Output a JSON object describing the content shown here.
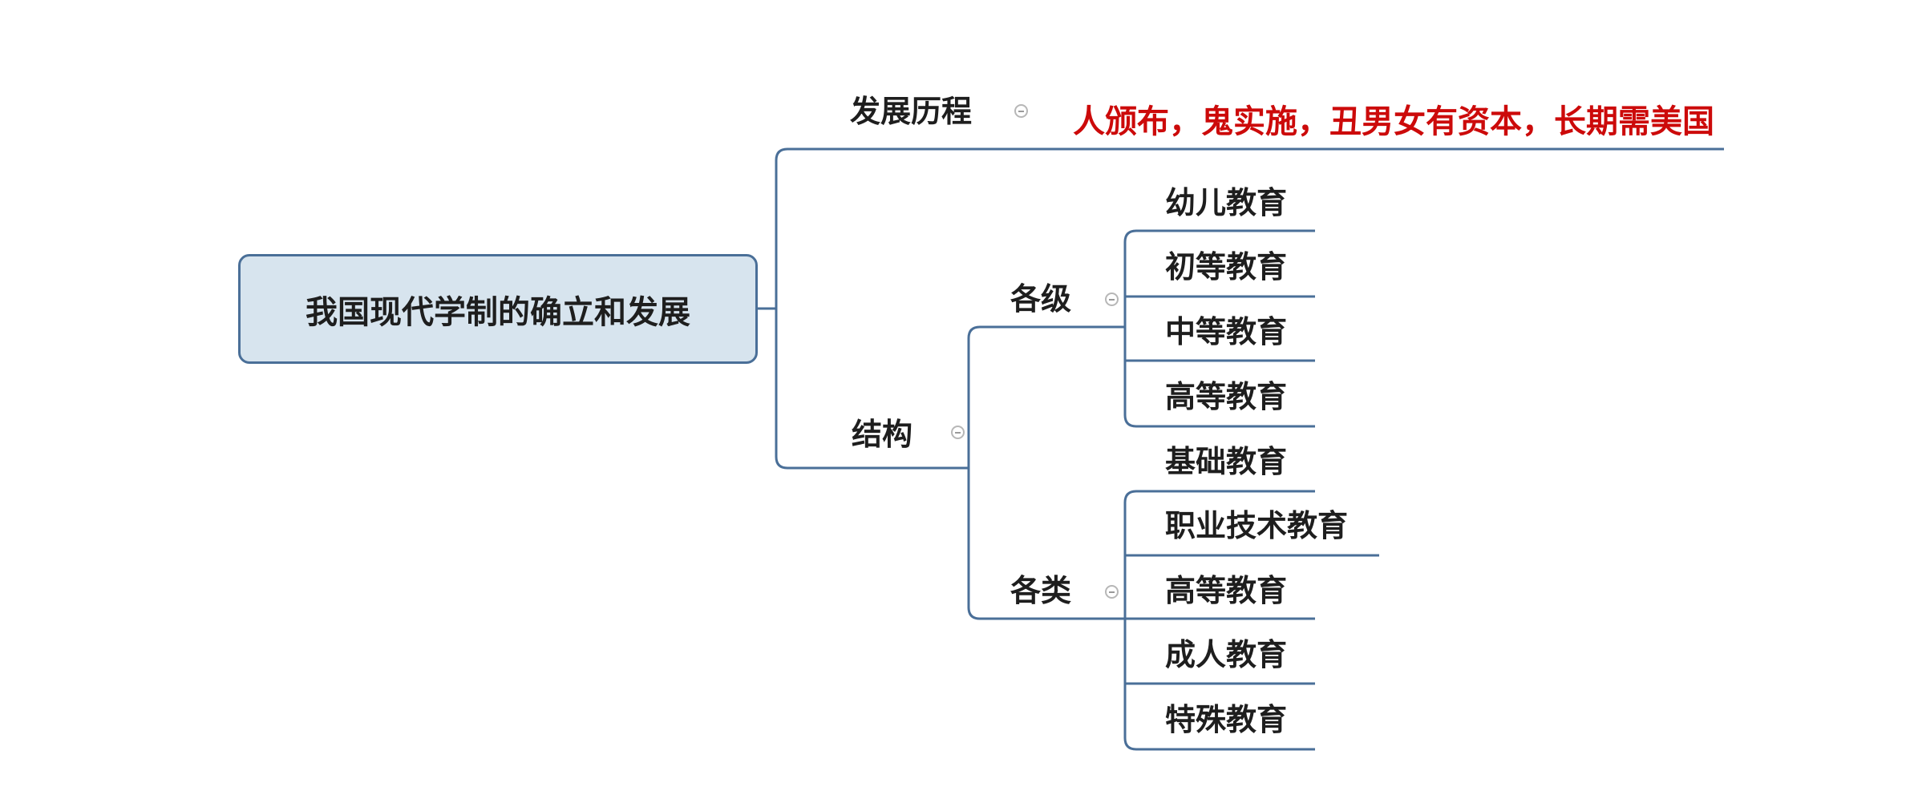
{
  "root": {
    "title": "我国现代学制的确立和发展"
  },
  "branches": {
    "history": {
      "label": "发展历程",
      "note": "人颁布，鬼实施，丑男女有资本，长期需美国"
    },
    "structure": {
      "label": "结构",
      "levels": {
        "label": "各级",
        "items": [
          "幼儿教育",
          "初等教育",
          "中等教育",
          "高等教育"
        ]
      },
      "types": {
        "label": "各类",
        "items": [
          "基础教育",
          "职业技术教育",
          "高等教育",
          "成人教育",
          "特殊教育"
        ]
      }
    }
  },
  "colors": {
    "connector": "#4a6f98",
    "root_fill": "#d7e4ee",
    "note_text": "#cc0a0a",
    "toggle": "#b7b7b7"
  },
  "icons": {
    "collapse": "minus-circle-icon"
  }
}
